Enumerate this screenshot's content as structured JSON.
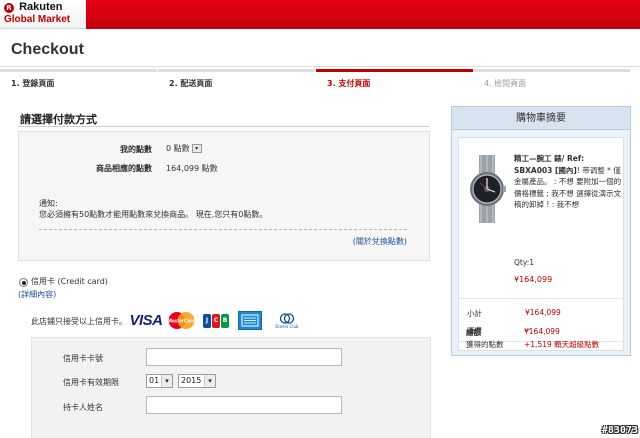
{
  "header": {
    "logo_brand": "Rakuten",
    "logo_sub": "Global Market",
    "accent_color": "#bf0000"
  },
  "page": {
    "title": "Checkout"
  },
  "steps": [
    {
      "label": "1. 登錄頁面",
      "state": "done"
    },
    {
      "label": "2. 配送頁面",
      "state": "done"
    },
    {
      "label": "3. 支付頁面",
      "state": "active"
    },
    {
      "label": "4. 檢閱頁面",
      "state": "future"
    }
  ],
  "payment": {
    "section_title": "請選擇付款方式",
    "points": {
      "my_points_label": "我的點數",
      "my_points_value": "0 點數",
      "product_points_label": "商品相應的點數",
      "product_points_value": "164,099 點數",
      "notice_title": "通知:",
      "notice_text": "您必須擁有50點數才能用點數來兌換商品。 現在,您只有0點數。",
      "link": "(關於兌換點數)"
    },
    "credit_card": {
      "option_label": "信用卡 (Credit card)",
      "details_link": "(詳細內容)",
      "accept_text": "此店鋪只接受以上信用卡。",
      "card_brands": [
        "VISA",
        "MasterCard",
        "JCB",
        "American Express",
        "Diners Club International"
      ]
    },
    "form": {
      "card_number_label": "信用卡卡號",
      "card_number_value": "",
      "expiry_label": "信用卡有效期限",
      "expiry_month": "01",
      "expiry_year": "2015",
      "holder_label": "持卡人姓名",
      "holder_value": ""
    }
  },
  "cart": {
    "title": "購物車摘要",
    "product_name_bold": "精工—腕工 錶/ Ref: SBXA003 [國內]",
    "product_name_rest": "! 带调整 * 僅金屬產品。 : 不想 要附加一個的價格標籤 ; 我不想 選擇從演示文稿的卸掉 ! : 我不想",
    "qty": "Qty:1",
    "price": "¥164,099",
    "subtotal_label": "小計",
    "subtotal_value": "¥164,099",
    "shipping_label": "運費",
    "shipping_value": "--",
    "total_label": "總額",
    "total_value": "¥164,099",
    "points_label": "獲得的點數",
    "points_value": "+1,519 顆天超級點數"
  },
  "watermark": "#83073"
}
